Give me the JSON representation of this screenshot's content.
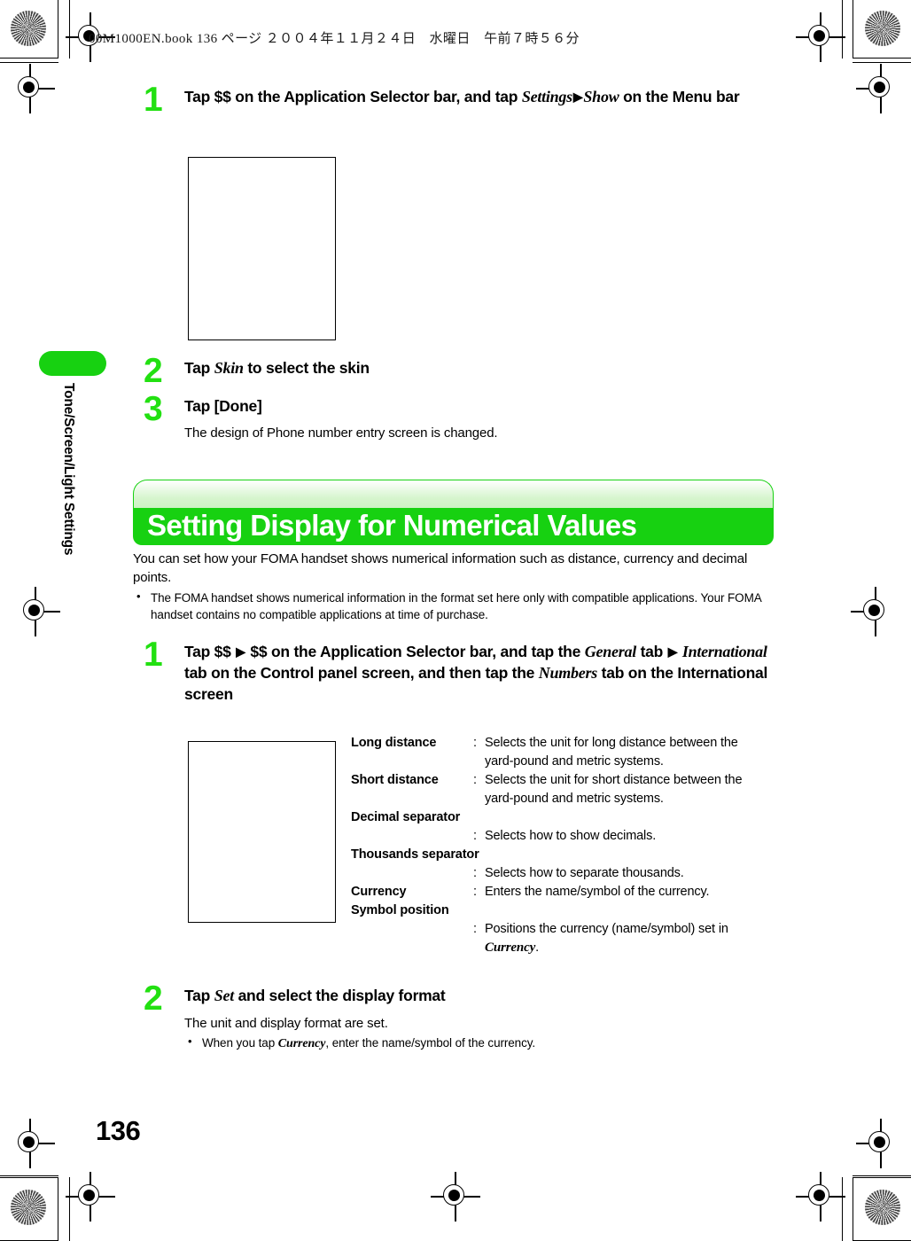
{
  "header": {
    "file_line": "00M1000EN.book  136 ページ  ２００４年１１月２４日　水曜日　午前７時５６分"
  },
  "side_tab": {
    "label": "Tone/Screen/Light Settings",
    "color": "#17d111"
  },
  "page": {
    "number": "136"
  },
  "section_top": {
    "steps": [
      {
        "num": "1",
        "title_parts": {
          "a": "Tap $$ on the Application Selector bar, and tap ",
          "i1": "Settings",
          "arrow": "▶",
          "i2": "Show",
          "b": " on the Menu bar"
        }
      },
      {
        "num": "2",
        "title_parts": {
          "a": "Tap ",
          "i1": "Skin",
          "b": " to select the skin"
        }
      },
      {
        "num": "3",
        "title_parts": {
          "a": "Tap [Done]"
        },
        "body": "The design of Phone number entry screen is changed."
      }
    ]
  },
  "banner": {
    "title": "Setting Display for Numerical Values",
    "bar_color": "#17d111",
    "top_color": "#cdf2c3"
  },
  "intro": {
    "paragraph": "You can set how your FOMA handset shows numerical information such as distance, currency and decimal points.",
    "bullets": [
      "The FOMA handset shows numerical information in the format set here only with compatible applications. Your FOMA handset contains no compatible applications at time of purchase."
    ]
  },
  "section_bottom": {
    "step1": {
      "num": "1",
      "title_parts": {
        "a": "Tap $$ ",
        "arrow1": "▶",
        "b": " $$ on the Application Selector bar, and tap the ",
        "i1": "General",
        "c": " tab ",
        "arrow2": "▶",
        "i2": "International",
        "d": " tab on the Control panel screen, and then tap the ",
        "i3": "Numbers",
        "e": " tab on the International screen"
      }
    },
    "definitions": [
      {
        "term": "Long distance",
        "colon": ":",
        "desc": "Selects the unit for long distance between the",
        "desc2": "yard-pound and metric systems.",
        "layout": "inline"
      },
      {
        "term": "Short distance",
        "colon": ":",
        "desc": "Selects the unit for short distance between the",
        "desc2": "yard-pound and metric systems.",
        "layout": "inline"
      },
      {
        "term": "Decimal separator",
        "colon": ":",
        "desc": "Selects how to show decimals.",
        "layout": "stacked"
      },
      {
        "term": "Thousands separator",
        "colon": ":",
        "desc": "Selects how to separate thousands.",
        "layout": "stacked"
      },
      {
        "term": "Currency",
        "colon": ":",
        "desc": "Enters the name/symbol of the currency.",
        "layout": "inline"
      },
      {
        "term": "Symbol position",
        "colon": ":",
        "desc": "Positions the currency (name/symbol) set in",
        "desc2_italic": "Currency",
        "desc2_tail": ".",
        "layout": "stacked"
      }
    ],
    "step2": {
      "num": "2",
      "title_parts": {
        "a": "Tap ",
        "i1": "Set",
        "b": " and select the display format"
      },
      "body": "The unit and display format are set.",
      "bullet_a": "When you tap ",
      "bullet_i": "Currency",
      "bullet_b": ", enter the name/symbol of the currency."
    }
  }
}
